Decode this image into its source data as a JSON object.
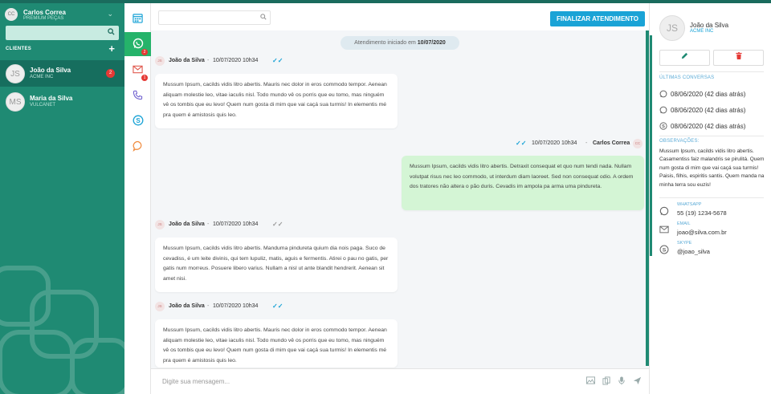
{
  "user": {
    "initials": "CC",
    "name": "Carlos Correa",
    "company": "PREMIUM PEÇAS"
  },
  "sidebar": {
    "clients_label": "CLIENTES",
    "clients": [
      {
        "initials": "JS",
        "name": "João da Silva",
        "company": "ACME INC",
        "unread": "2",
        "active": true
      },
      {
        "initials": "MS",
        "name": "Maria da Silva",
        "company": "VULCANET",
        "unread": "",
        "active": false
      }
    ]
  },
  "rail": {
    "items": [
      {
        "icon": "calendar-icon",
        "badge": ""
      },
      {
        "icon": "whatsapp-icon",
        "badge": "2",
        "active": true
      },
      {
        "icon": "email-icon",
        "badge": "1"
      },
      {
        "icon": "phone-icon",
        "badge": ""
      },
      {
        "icon": "skype-icon",
        "badge": ""
      },
      {
        "icon": "chat-icon",
        "badge": ""
      }
    ]
  },
  "chat": {
    "finish_label": "FINALIZAR ATENDIMENTO",
    "started_prefix": "Atendimento iniciado em",
    "started_date": "10/07/2020",
    "composer_placeholder": "Digite sua mensagem...",
    "messages": [
      {
        "direction": "in",
        "initials": "JS",
        "author": "João da Silva",
        "time": "10/07/2020 10h34",
        "read": true,
        "text": "Mussum Ipsum, cacilds vidis litro abertis. Mauris nec dolor in eros commodo tempor. Aenean aliquam molestie leo, vitae iaculis nisl. Todo mundo vê os porris que eu tomo, mas ninguém vê os tombis que eu levo! Quem num gosta di mim que vai caçá sua turmis! In elementis mé pra quem é amistosis quis leo."
      },
      {
        "direction": "out",
        "initials": "CC",
        "author": "Carlos Correa",
        "time": "10/07/2020 10h34",
        "read": true,
        "text": "Mussum Ipsum, cacilds vidis litro abertis. Detraxit consequat et quo num tendi nada. Nullam volutpat risus nec leo commodo, ut interdum diam laoreet. Sed non consequat odio. A ordem dos tratores não altera o pão duris. Cevadis im ampola pa arma uma pindureta."
      },
      {
        "direction": "in",
        "initials": "JS",
        "author": "João da Silva",
        "time": "10/07/2020 10h34",
        "read": false,
        "text": "Mussum Ipsum, cacilds vidis litro abertis. Manduma pindureta quium dia nois paga. Suco de cevadiss, é um leite divinis, qui tem lupuliz, matis, aguis e fermentis. Atirei o pau no gatis, per gatis num morreus. Posuere libero varius. Nullam a nisl ut ante blandit hendrerit. Aenean sit amet nisi."
      },
      {
        "direction": "in",
        "initials": "JS",
        "author": "João da Silva",
        "time": "10/07/2020 10h34",
        "read": true,
        "text": "Mussum Ipsum, cacilds vidis litro abertis. Mauris nec dolor in eros commodo tempor. Aenean aliquam molestie leo, vitae iaculis nisl. Todo mundo vê os porris que eu tomo, mas ninguém vê os tombis que eu levo! Quem num gosta di mim que vai caçá sua turmis! In elementis mé pra quem é amistosis quis leo."
      }
    ]
  },
  "details": {
    "initials": "JS",
    "name": "João da Silva",
    "company": "ACME INC",
    "last_conversations_label": "ÚLTIMAS CONVERSAS",
    "conversations": [
      {
        "icon": "whatsapp-icon",
        "text": "08/06/2020 (42 dias atrás)"
      },
      {
        "icon": "whatsapp-icon",
        "text": "08/06/2020 (42 dias atrás)"
      },
      {
        "icon": "skype-icon",
        "text": "08/06/2020 (42 dias atrás)"
      }
    ],
    "notes_label": "OBSERVAÇÕES:",
    "notes": "Mussum Ipsum, cacilds vidis litro abertis. Casamentiss faiz malandris se pirulitá. Quem num gosta di mim que vai caçá sua turmis! Paisis, filhis, espiritis santis. Quem manda na minha terra sou euzis!",
    "contacts": [
      {
        "icon": "whatsapp-icon",
        "label": "WHATSAPP",
        "value": "55 (19) 1234-5678"
      },
      {
        "icon": "email-icon",
        "label": "EMAIL",
        "value": "joao@silva.com.br"
      },
      {
        "icon": "skype-icon",
        "label": "SKYPE",
        "value": "@joao_silva"
      }
    ]
  },
  "colors": {
    "sidebar": "#1f8a73",
    "accent": "#1aa3d6",
    "whatsapp": "#25b36a",
    "badge": "#e53935"
  }
}
